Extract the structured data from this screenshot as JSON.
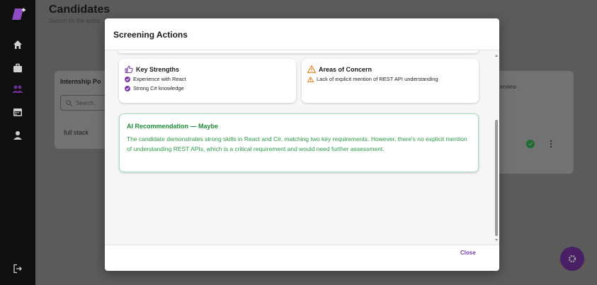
{
  "colors": {
    "accent": "#7b3aa6",
    "success": "#1d8a3a",
    "warning": "#e67e22",
    "sidebar": "#0f0f10"
  },
  "sidebar": {
    "items": [
      {
        "icon": "home-icon"
      },
      {
        "icon": "briefcase-icon"
      },
      {
        "icon": "users-icon",
        "active": true
      },
      {
        "icon": "calendar-icon"
      },
      {
        "icon": "person-icon"
      },
      {
        "icon": "logout-icon"
      }
    ]
  },
  "page": {
    "title": "Candidates",
    "subtitle": "Search for the applic"
  },
  "background": {
    "card_title": "Internship Po",
    "search_placeholder": "Search...",
    "row_text": "full stack",
    "column_header": "erview"
  },
  "modal": {
    "title": "Screening Actions",
    "strengths": {
      "title": "Key Strengths",
      "items": [
        "Experience with React",
        "Strong C# knowledge"
      ]
    },
    "concerns": {
      "title": "Areas of Concern",
      "items": [
        "Lack of explicit mention of REST API understanding"
      ]
    },
    "recommendation": {
      "title": "AI Recommendation — Maybe",
      "body": "The candidate demonstrates strong skills in React and C#, matching two key requirements. However, there's no explicit mention of understanding REST APIs, which is a critical requirement and would need further assessment."
    },
    "close_label": "Close"
  }
}
